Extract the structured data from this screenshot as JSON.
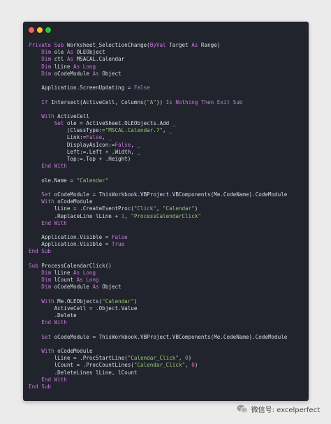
{
  "colors": {
    "page_background": "#ebebeb",
    "editor_background": "#21242c",
    "keyword": "#c678dd",
    "string": "#98c379",
    "number": "#e06c75",
    "text": "#d6dbe2",
    "dot_red": "#ff5f57",
    "dot_yellow": "#febc2e",
    "dot_green": "#28c840"
  },
  "window_controls": [
    "close-dot",
    "minimize-dot",
    "maximize-dot"
  ],
  "code_lines": [
    [
      [
        "kw",
        "Private Sub "
      ],
      [
        "id",
        "Worksheet_SelectionChange("
      ],
      [
        "kw",
        "ByVal "
      ],
      [
        "id",
        "Target "
      ],
      [
        "kw",
        "As "
      ],
      [
        "id",
        "Range)"
      ]
    ],
    [
      [
        "id",
        "    "
      ],
      [
        "kw",
        "Dim "
      ],
      [
        "id",
        "ole "
      ],
      [
        "kw",
        "As "
      ],
      [
        "id",
        "OLEObject"
      ]
    ],
    [
      [
        "id",
        "    "
      ],
      [
        "kw",
        "Dim "
      ],
      [
        "id",
        "ctl "
      ],
      [
        "kw",
        "As "
      ],
      [
        "id",
        "MSACAL.Calendar"
      ]
    ],
    [
      [
        "id",
        "    "
      ],
      [
        "kw",
        "Dim "
      ],
      [
        "id",
        "lLine "
      ],
      [
        "kw",
        "As Long"
      ]
    ],
    [
      [
        "id",
        "    "
      ],
      [
        "kw",
        "Dim "
      ],
      [
        "id",
        "oCodeModule "
      ],
      [
        "kw",
        "As "
      ],
      [
        "id",
        "Object"
      ]
    ],
    [
      [
        "id",
        ""
      ]
    ],
    [
      [
        "id",
        "    Application.ScreenUpdating = "
      ],
      [
        "kw",
        "False"
      ]
    ],
    [
      [
        "id",
        ""
      ]
    ],
    [
      [
        "id",
        "    "
      ],
      [
        "kw",
        "If "
      ],
      [
        "id",
        "Intersect(ActiveCell, Columns("
      ],
      [
        "str",
        "\"A\""
      ],
      [
        "id",
        ")) "
      ],
      [
        "kw",
        "Is Nothing Then Exit Sub"
      ]
    ],
    [
      [
        "id",
        ""
      ]
    ],
    [
      [
        "id",
        "    "
      ],
      [
        "kw",
        "With "
      ],
      [
        "id",
        "ActiveCell"
      ]
    ],
    [
      [
        "id",
        "        "
      ],
      [
        "kw",
        "Set "
      ],
      [
        "id",
        "ole = ActiveSheet.OLEObjects.Add _"
      ]
    ],
    [
      [
        "id",
        "            (ClassType:="
      ],
      [
        "str",
        "\"MSCAL.Calendar.7\""
      ],
      [
        "id",
        ", _"
      ]
    ],
    [
      [
        "id",
        "            Link:="
      ],
      [
        "kw",
        "False"
      ],
      [
        "id",
        ", _"
      ]
    ],
    [
      [
        "id",
        "            DisplayAsIcon:="
      ],
      [
        "kw",
        "False"
      ],
      [
        "id",
        ", _"
      ]
    ],
    [
      [
        "id",
        "            Left:=.Left + .Width, _"
      ]
    ],
    [
      [
        "id",
        "            Top:=.Top + .Height)"
      ]
    ],
    [
      [
        "id",
        "    "
      ],
      [
        "kw",
        "End With"
      ]
    ],
    [
      [
        "id",
        ""
      ]
    ],
    [
      [
        "id",
        "    ole.Name = "
      ],
      [
        "str",
        "\"Calendar\""
      ]
    ],
    [
      [
        "id",
        ""
      ]
    ],
    [
      [
        "id",
        "    "
      ],
      [
        "kw",
        "Set "
      ],
      [
        "id",
        "oCodeModule = ThisWorkbook.VBProject.VBComponents(Me.CodeName).CodeModule"
      ]
    ],
    [
      [
        "id",
        "    "
      ],
      [
        "kw",
        "With "
      ],
      [
        "id",
        "oCodeModule"
      ]
    ],
    [
      [
        "id",
        "        lLine = .CreateEventProc("
      ],
      [
        "str",
        "\"Click\""
      ],
      [
        "id",
        ", "
      ],
      [
        "str",
        "\"Calendar\""
      ],
      [
        "id",
        ")"
      ]
    ],
    [
      [
        "id",
        "        .ReplaceLine lLine + "
      ],
      [
        "num",
        "1"
      ],
      [
        "id",
        ", "
      ],
      [
        "str",
        "\"ProcessCalendarClick\""
      ]
    ],
    [
      [
        "id",
        "    "
      ],
      [
        "kw",
        "End With"
      ]
    ],
    [
      [
        "id",
        ""
      ]
    ],
    [
      [
        "id",
        "    Application.Visible = "
      ],
      [
        "kw",
        "False"
      ]
    ],
    [
      [
        "id",
        "    Application.Visible = "
      ],
      [
        "kw",
        "True"
      ]
    ],
    [
      [
        "kw",
        "End Sub"
      ]
    ],
    [
      [
        "id",
        ""
      ]
    ],
    [
      [
        "kw",
        "Sub "
      ],
      [
        "id",
        "ProcessCalendarClick()"
      ]
    ],
    [
      [
        "id",
        "    "
      ],
      [
        "kw",
        "Dim "
      ],
      [
        "id",
        "lLine "
      ],
      [
        "kw",
        "As Long"
      ]
    ],
    [
      [
        "id",
        "    "
      ],
      [
        "kw",
        "Dim "
      ],
      [
        "id",
        "lCount "
      ],
      [
        "kw",
        "As Long"
      ]
    ],
    [
      [
        "id",
        "    "
      ],
      [
        "kw",
        "Dim "
      ],
      [
        "id",
        "oCodeModule "
      ],
      [
        "kw",
        "As "
      ],
      [
        "id",
        "Object"
      ]
    ],
    [
      [
        "id",
        ""
      ]
    ],
    [
      [
        "id",
        "    "
      ],
      [
        "kw",
        "With "
      ],
      [
        "id",
        "Me.OLEObjects("
      ],
      [
        "str",
        "\"Calendar\""
      ],
      [
        "id",
        ")"
      ]
    ],
    [
      [
        "id",
        "        ActiveCell = .Object.Value"
      ]
    ],
    [
      [
        "id",
        "        .Delete"
      ]
    ],
    [
      [
        "id",
        "    "
      ],
      [
        "kw",
        "End With"
      ]
    ],
    [
      [
        "id",
        ""
      ]
    ],
    [
      [
        "id",
        "    "
      ],
      [
        "kw",
        "Set "
      ],
      [
        "id",
        "oCodeModule = ThisWorkbook.VBProject.VBComponents(Me.CodeName).CodeModule"
      ]
    ],
    [
      [
        "id",
        ""
      ]
    ],
    [
      [
        "id",
        "    "
      ],
      [
        "kw",
        "With "
      ],
      [
        "id",
        "oCodeModule"
      ]
    ],
    [
      [
        "id",
        "        lLine = .ProcStartLine("
      ],
      [
        "str",
        "\"Calendar_Click\""
      ],
      [
        "id",
        ", "
      ],
      [
        "num",
        "0"
      ],
      [
        "id",
        ")"
      ]
    ],
    [
      [
        "id",
        "        lCount = .ProcCountLines("
      ],
      [
        "str",
        "\"Calendar_Click\""
      ],
      [
        "id",
        ", "
      ],
      [
        "num",
        "0"
      ],
      [
        "id",
        ")"
      ]
    ],
    [
      [
        "id",
        "        .DeleteLines lLine, lCount"
      ]
    ],
    [
      [
        "id",
        "    "
      ],
      [
        "kw",
        "End With"
      ]
    ],
    [
      [
        "kw",
        "End Sub"
      ]
    ]
  ],
  "watermark": {
    "icon": "wechat-icon",
    "text": "微信号: excelperfect"
  }
}
